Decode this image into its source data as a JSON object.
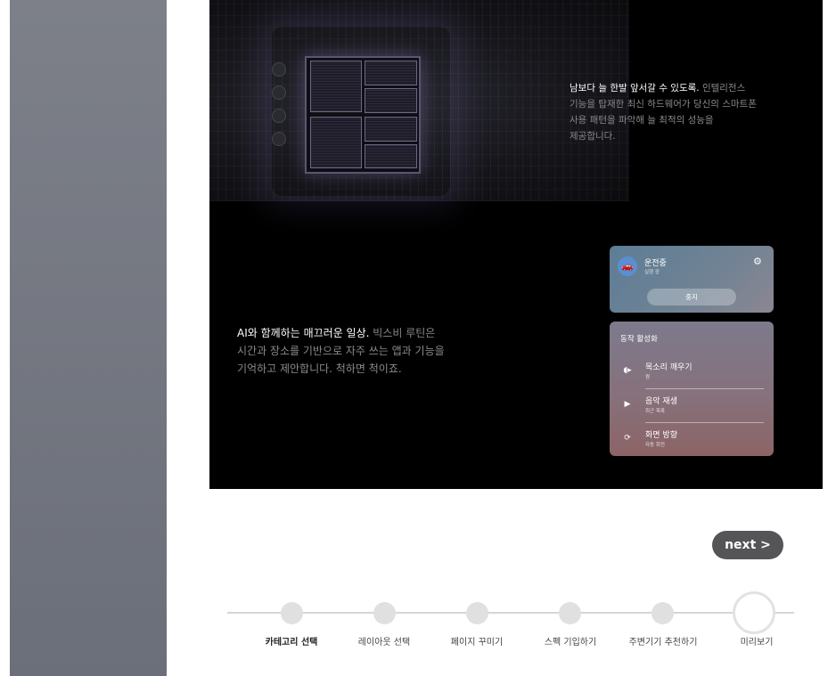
{
  "feature_top": {
    "highlight": "남보다 늘 한발 앞서갈 수 있도록.",
    "rest_line1": " 인텔리전스",
    "line2": "기능을 탑재한 최신 하드웨어가 당신의 스마트폰",
    "line3": "사용 패턴을 파악해 늘 최적의 성능을",
    "line4": "제공합니다."
  },
  "feature_mid": {
    "highlight": "AI와 함께하는 매끄러운 일상.",
    "rest_line1": " 빅스비 루틴은",
    "line2": "시간과 장소를 기반으로 자주 쓰는 앱과 기능을",
    "line3": "기억하고 제안합니다. 척하면 척이죠."
  },
  "routine_card": {
    "title": "운전중",
    "subtitle": "실행 중",
    "stop_label": "중지"
  },
  "actions_card": {
    "heading": "동작 활성화",
    "items": [
      {
        "title": "목소리 깨우기",
        "subtitle": "켬"
      },
      {
        "title": "음악 재생",
        "subtitle": "최근 목록"
      },
      {
        "title": "화면 방향",
        "subtitle": "자동 회전"
      }
    ]
  },
  "next_label": "next >",
  "steps": [
    {
      "label": "카테고리 선택",
      "active": true
    },
    {
      "label": "레이아웃 선택",
      "active": false
    },
    {
      "label": "페이지 꾸미기",
      "active": false
    },
    {
      "label": "스펙 기입하기",
      "active": false
    },
    {
      "label": "주변기기 추천하기",
      "active": false
    },
    {
      "label": "미리보기",
      "active": false
    }
  ]
}
